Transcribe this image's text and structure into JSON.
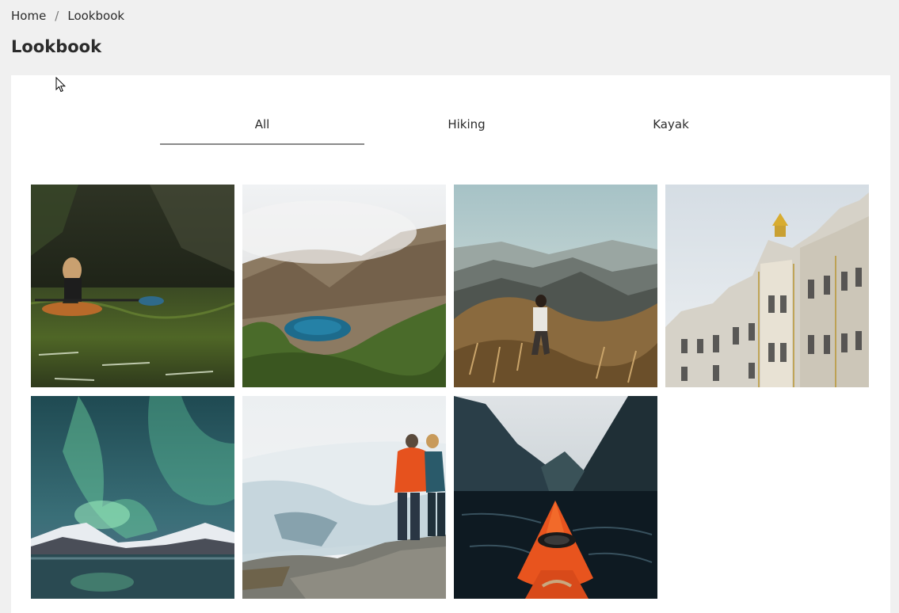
{
  "breadcrumb": {
    "home": "Home",
    "separator": "/",
    "current": "Lookbook"
  },
  "page": {
    "title": "Lookbook"
  },
  "tabs": [
    {
      "label": "All",
      "active": true
    },
    {
      "label": "Hiking",
      "active": false
    },
    {
      "label": "Kayak",
      "active": false
    }
  ],
  "gallery": [
    {
      "subject": "kayaker paddling on a forest river"
    },
    {
      "subject": "blue crater lake among misty mountains"
    },
    {
      "subject": "hiker in golden grass over mountain valley"
    },
    {
      "subject": "ornate baroque guildhall facade with gold statue"
    },
    {
      "subject": "green aurora over snowy mountains and lake"
    },
    {
      "subject": "two hikers on rocks facing snowy valley"
    },
    {
      "subject": "orange kayak bow in a dark fjord"
    }
  ],
  "colors": {
    "page_background": "#f0f0f0",
    "panel_background": "#ffffff",
    "text": "#2b2b2b",
    "active_tab_underline": "#8a8a8a"
  }
}
